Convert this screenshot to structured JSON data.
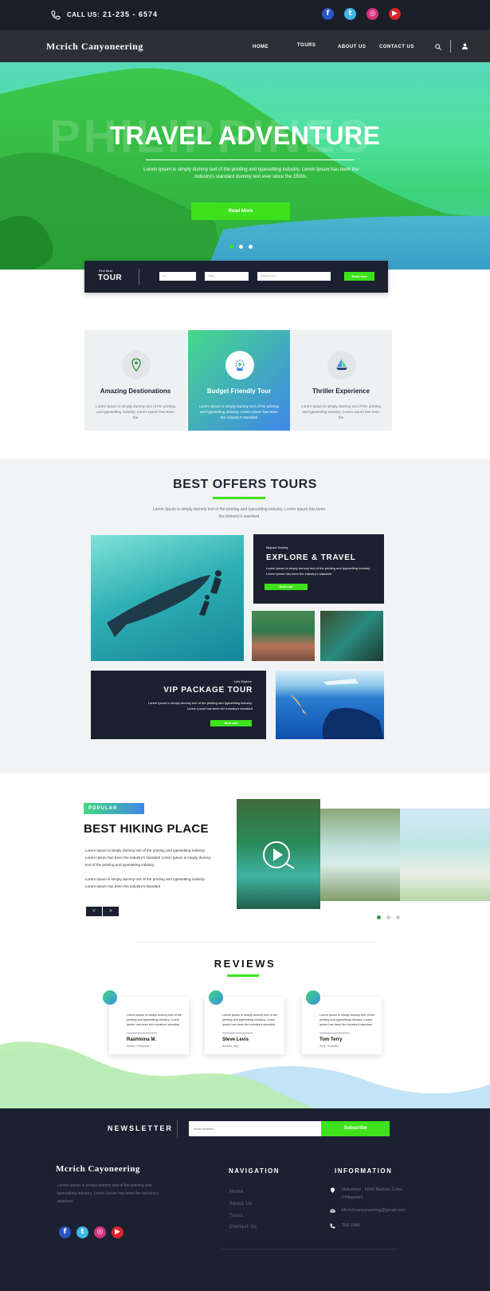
{
  "topbar": {
    "call_label": "CALL US:",
    "phone": "21-235 - 6574",
    "social": [
      "facebook-icon",
      "twitter-icon",
      "instagram-icon",
      "youtube-icon"
    ]
  },
  "nav": {
    "brand": "Mcrich Canyoneering",
    "links": [
      "HOME",
      "TOURS",
      "ABOUT US",
      "CONTACT US"
    ]
  },
  "hero": {
    "ghost_text": "PHILIPPINES",
    "title": "TRAVEL ADVENTURE",
    "subtitle": "Lorem Ipsum is simply dummy text of the printing and typesetting industry. Lorem Ipsum has been the industry's standard dummy text ever since the 1500s.",
    "button": "Read More"
  },
  "search": {
    "find_label": "Find Best",
    "tour_label": "TOUR",
    "fields": [
      "Sel",
      "Days",
      "Select a tour"
    ],
    "button": "Book now"
  },
  "features": [
    {
      "icon": "map-pin-icon",
      "title": "Amazing Destionations",
      "text": "Lorem Ipsum is simply dummy text of the printing and typesetting industry. Lorem Ipsum has been the"
    },
    {
      "icon": "gear-piggy-icon",
      "title": "Budget Friendly Tour",
      "text": "Lorem Ipsum is simply dummy text of the printing and typesetting industry. Lorem Ipsum has been the industry's standard"
    },
    {
      "icon": "sailboat-icon",
      "title": "Thriller Experience",
      "text": "Lorem Ipsum is simply dummy text of the printing and typesetting industry. Lorem Ipsum has been the"
    }
  ],
  "offers": {
    "heading": "BEST OFFERS TOURS",
    "subtitle": "Lorem Ipsum is simply dummy text of the printing and typesetting industry. Lorem Ipsum has been the industry's standard",
    "explore": {
      "kicker": "Migrant Society",
      "title": "EXPLORE  & TRAVEL",
      "text": "Lorem Ipsum is simply dummy text of the printing and typesetting industry. Lorem Ipsum has been the industry's standard",
      "button": "Book now"
    },
    "vip": {
      "kicker": "Lets Explore",
      "title": "VIP PACKAGE TOUR",
      "text": "Lorem Ipsum is simply dummy text of the printing and typesetting industry. Lorem Ipsum has been the industry's standard",
      "button": "Book now"
    }
  },
  "popular": {
    "badge": "POPULAR",
    "heading": "BEST HIKING PLACE",
    "para1": "Lorem Ipsum is simply dummy text of the printing and typesetting industry. Lorem Ipsum has been the industry's standard Lorem Ipsum is simply dummy text of the printing and typesetting industry.",
    "para2": "Lorem Ipsum is simply dummy text of the printing and typesetting industry. Lorem Ipsum has been the industry's standard",
    "prev": "<",
    "next": ">"
  },
  "reviews": {
    "heading": "REVIEWS",
    "items": [
      {
        "text": "Lorem Ipsum is simply dummy text of the printing and typesetting industry. Lorem Ipsum has been the industry's standard",
        "name": "Rashmina M.",
        "location": "Manila, Philippines"
      },
      {
        "text": "Lorem Ipsum is simply dummy text of the printing and typesetting industry. Lorem Ipsum has been the industry's standard",
        "name": "Steve Levis",
        "location": "Bavaria, Italy"
      },
      {
        "text": "Lorem Ipsum is simply dummy text of the printing and typesetting industry. Lorem Ipsum has been the industry's standard",
        "name": "Tom Terry",
        "location": "Perth, Australia"
      }
    ]
  },
  "newsletter": {
    "title": "NEWSLETTER",
    "placeholder": "Email address",
    "button": "Subscribe"
  },
  "footer": {
    "brand": "Mcrich Cayoneering",
    "text": "Lorem Ipsum is simply dummy text of the printing and typesetting industry. Lorem Ipsum has been the industry's standard.",
    "nav_title": "NAVIGATION",
    "nav_links": [
      "Home",
      "About Us",
      "Tours",
      "Contact Us"
    ],
    "info_title": "INFORMATION",
    "address": "Matutinao , 6000 Badian, Cebu Philippines",
    "email": "Mcrichcanyoneering@gmail.com",
    "phone": "256-1890"
  },
  "colors": {
    "accent": "#3ee21c",
    "dark": "#1b2130",
    "gradient_start": "#43d982",
    "gradient_end": "#3f86e8"
  }
}
